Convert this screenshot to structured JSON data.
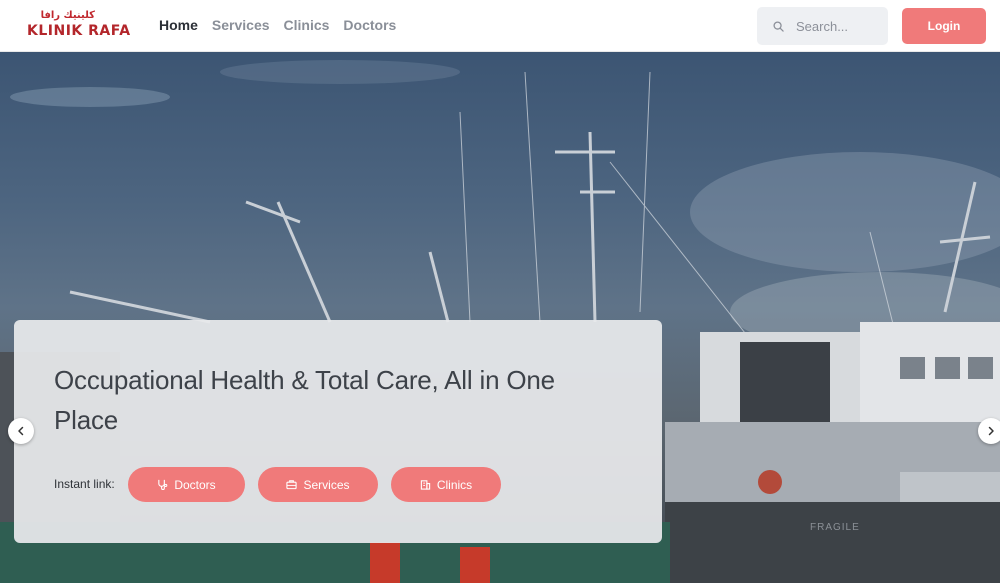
{
  "header": {
    "logo": {
      "arabic": "كلينيك رافا",
      "english_1": "KLINIK",
      "english_2": "RAFA"
    },
    "nav": [
      {
        "label": "Home",
        "active": true
      },
      {
        "label": "Services",
        "active": false
      },
      {
        "label": "Clinics",
        "active": false
      },
      {
        "label": "Doctors",
        "active": false
      }
    ],
    "search": {
      "placeholder": "Search...",
      "value": ""
    },
    "login_label": "Login"
  },
  "hero": {
    "headline": "Occupational Health & Total Care, All in One Place",
    "instant_link_label": "Instant link:",
    "links": [
      {
        "label": "Doctors",
        "icon": "stethoscope-icon"
      },
      {
        "label": "Services",
        "icon": "briefcase-icon"
      },
      {
        "label": "Clinics",
        "icon": "building-icon"
      }
    ],
    "background_text": "FRAGILE"
  },
  "colors": {
    "accent": "#f07a7a",
    "brand": "#b3262b",
    "nav_active": "#2b2f36",
    "nav_inactive": "#8a8f98"
  }
}
